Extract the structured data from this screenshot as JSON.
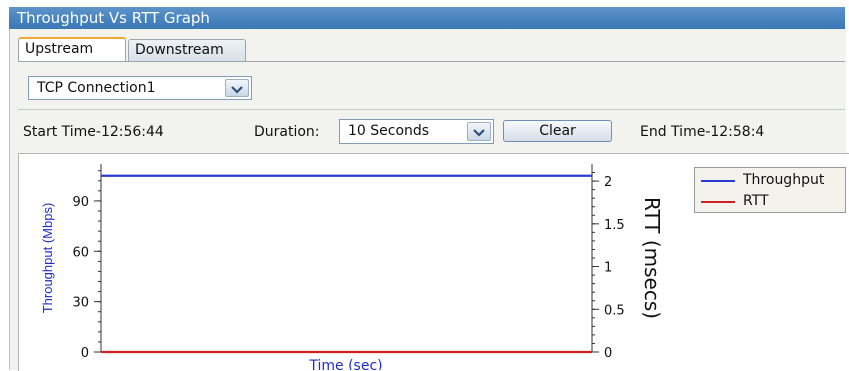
{
  "window": {
    "title": "Throughput Vs RTT Graph"
  },
  "tabs": [
    {
      "label": "Upstream",
      "active": true
    },
    {
      "label": "Downstream",
      "active": false
    }
  ],
  "connection_select": {
    "value": "TCP Connection1"
  },
  "controls": {
    "start_time": "Start Time-12:56:44",
    "duration_label": "Duration:",
    "duration_value": "10 Seconds",
    "clear_label": "Clear",
    "end_time": "End Time-12:58:4"
  },
  "colors": {
    "throughput": "#2a3bd6",
    "rtt": "#d02020",
    "title_bar": "#4a85c0"
  },
  "icons": {
    "dropdown": "chevron-down-icon"
  },
  "chart_data": {
    "type": "line",
    "xlabel": "Time (sec)",
    "ylabel": "Throughput (Mbps)",
    "y2label": "RTT (msecs)",
    "ylim": [
      0,
      112
    ],
    "y2lim": [
      0,
      2.2
    ],
    "yticks": [
      0,
      30,
      60,
      90
    ],
    "y2ticks": [
      0,
      0.5,
      1,
      1.5,
      2
    ],
    "legend_position": "top-right",
    "grid": false,
    "series": [
      {
        "name": "Throughput",
        "axis": "left",
        "color": "#2a3bd6",
        "x": [
          0,
          10
        ],
        "y": [
          105,
          105
        ]
      },
      {
        "name": "RTT",
        "axis": "right",
        "color": "#d02020",
        "x": [
          0,
          10
        ],
        "y": [
          0,
          0
        ]
      }
    ]
  }
}
